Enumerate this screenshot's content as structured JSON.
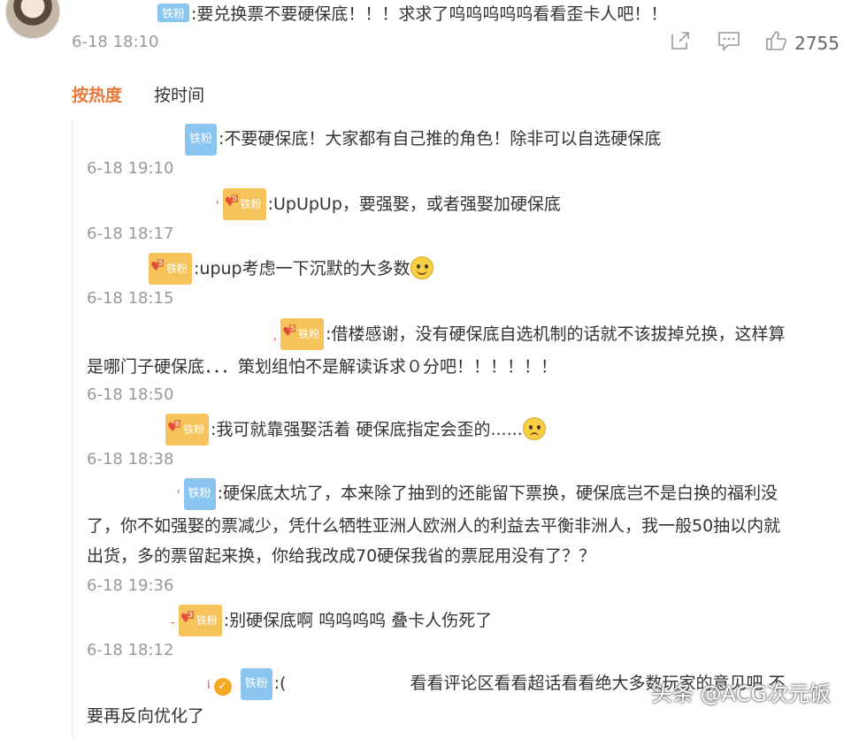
{
  "top_comment": {
    "badge": "铁粉",
    "text": ":要兑换票不要硬保底！！！求求了呜呜呜呜呜看看歪卡人吧！！",
    "time": "6-18 18:10",
    "like_count": "2755",
    "icons": [
      "share-icon",
      "comment-icon",
      "thumbs-up-icon"
    ]
  },
  "sort": {
    "hot": "按热度",
    "time": "按时间"
  },
  "replies": [
    {
      "badge": "铁粉",
      "badge_type": "plain",
      "text": ":不要硬保底！大家都有自己推的角色！除非可以自选硬保底",
      "time": "6-18 19:10"
    },
    {
      "badge": "铁粉",
      "badge_type": "fan",
      "level": "5",
      "text": ":UpUpUp，要强娶，或者强娶加硬保底",
      "time": "6-18 18:17"
    },
    {
      "badge": "铁粉",
      "badge_type": "fan",
      "level": "5",
      "text": ":upup考虑一下沉默的大多数",
      "emoji": "smile",
      "time": "6-18 18:15"
    },
    {
      "badge": "铁粉",
      "badge_type": "fan",
      "level": "5",
      "text": ":借楼感谢，没有硬保底自选机制的话就不该拔掉兑换，这样算",
      "text2": "是哪门子硬保底．．．策划组怕不是解读诉求０分吧！！！！！！",
      "time": "6-18 18:50"
    },
    {
      "badge": "铁粉",
      "badge_type": "fan",
      "level": "6",
      "text": ":我可就靠强娶活着 硬保底指定会歪的......",
      "emoji": "sad",
      "time": "6-18 18:38"
    },
    {
      "badge": "铁粉",
      "badge_type": "plain",
      "text": ":硬保底太坑了，本来除了抽到的还能留下票换，硬保底岂不是白换的福利没",
      "text2": "了，你不如强娶的票减少，凭什么牺牲亚洲人欧洲人的利益去平衡非洲人，我一般50抽以内就",
      "text3": "出货，多的票留起来换，你给我改成70硬保我省的票屁用没有了？？",
      "time": "6-18 19:36"
    },
    {
      "badge": "铁粉",
      "badge_type": "fan",
      "level": "3",
      "text": ":别硬保底啊 呜呜呜呜 叠卡人伤死了",
      "time": "6-18 18:12"
    },
    {
      "badge": "铁粉",
      "badge_type": "plain",
      "prefix": ":(",
      "text": "看看评论区看看超话看看绝大多数玩家的意见吧 不",
      "text2": "要再反向优化了"
    }
  ],
  "watermark": "头条 @ACG次元饭"
}
